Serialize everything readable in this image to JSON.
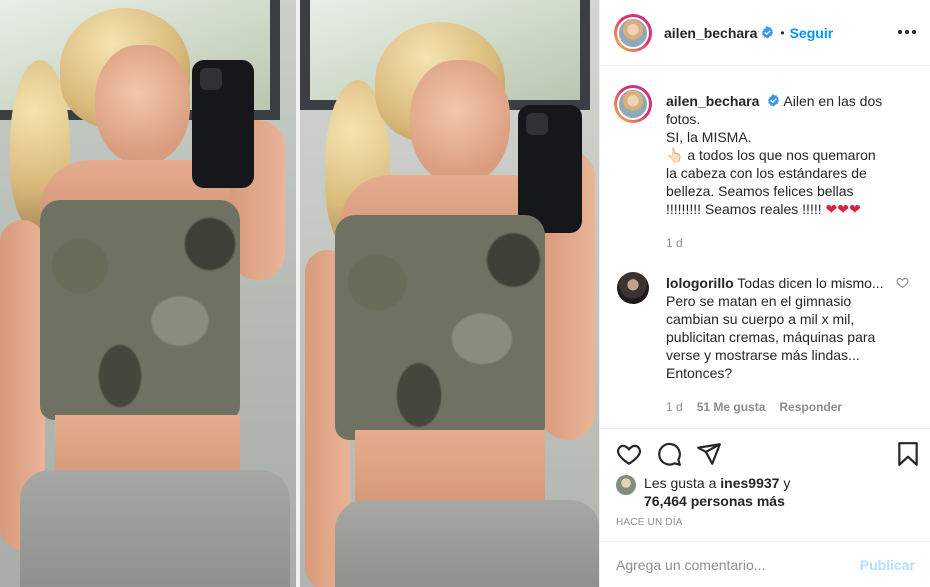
{
  "post": {
    "username": "ailen_bechara",
    "follow_label": "Seguir",
    "dot": "•",
    "caption": {
      "username": "ailen_bechara",
      "line1": "Ailen en las dos fotos.",
      "line2": "SI, la MISMA.",
      "line3": "👆🏻 a todos los que nos quemaron la cabeza con los estándares de belleza. Seamos felices bellas !!!!!!!!! Seamos reales !!!!! ",
      "hearts": "❤❤❤",
      "age": "1 d"
    },
    "comment": {
      "username": "lologorillo",
      "text": "Todas dicen lo mismo... Pero se matan en el gimnasio cambian su cuerpo a mil x mil, publicitan cremas, máquinas para verse y mostrarse más lindas... Entonces?",
      "age": "1 d",
      "likes": "51 Me gusta",
      "reply_label": "Responder"
    },
    "likes": {
      "prefix": "Les gusta a",
      "user": "ines9937",
      "joiner": "y",
      "others": "76,464 personas más"
    },
    "timestamp": "Hace un día",
    "composer": {
      "placeholder": "Agrega un comentario...",
      "publish_label": "Publicar"
    }
  },
  "icons": {
    "verified": "verified-badge-icon",
    "more": "more-options-icon",
    "like": "heart-icon",
    "comment": "comment-icon",
    "share": "paper-plane-icon",
    "save": "bookmark-icon"
  },
  "colors": {
    "link_blue": "#0095f6",
    "publish_disabled": "#b2dffc",
    "muted": "#8e8e8e",
    "text": "#262626"
  }
}
